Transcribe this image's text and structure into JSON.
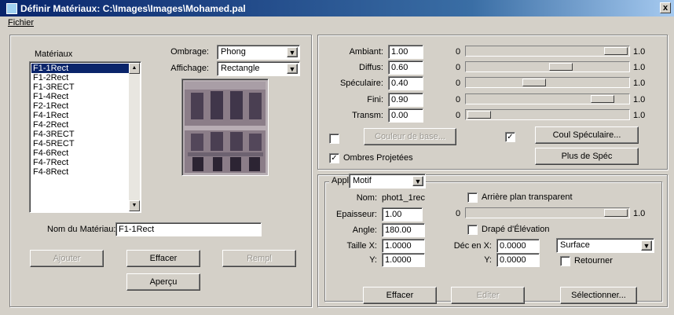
{
  "window": {
    "title": "Définir Matériaux: C:\\Images\\Images\\Mohamed.pal",
    "close_glyph": "x"
  },
  "menu": {
    "file": "Fichier"
  },
  "materials": {
    "list_label": "Matériaux",
    "items": [
      "F1-1Rect",
      "F1-2Rect",
      "F1-3RECT",
      "F1-4Rect",
      "F2-1Rect",
      "F4-1Rect",
      "F4-2Rect",
      "F4-3RECT",
      "F4-5RECT",
      "F4-6Rect",
      "F4-7Rect",
      "F4-8Rect"
    ],
    "selected_index": 0,
    "name_label": "Nom du Matériau:",
    "name_value": "F1-1Rect"
  },
  "shading": {
    "label": "Ombrage:",
    "value": "Phong"
  },
  "display": {
    "label": "Affichage:",
    "value": "Rectangle"
  },
  "left_buttons": {
    "add": "Ajouter",
    "delete": "Effacer",
    "fill": "Rempl",
    "preview": "Aperçu"
  },
  "properties": [
    {
      "label": "Ambiant:",
      "value": "1.00",
      "min": "0",
      "max": "1.0",
      "level": 1.0
    },
    {
      "label": "Diffus:",
      "value": "0.60",
      "min": "0",
      "max": "1.0",
      "level": 0.6
    },
    {
      "label": "Spéculaire:",
      "value": "0.40",
      "min": "0",
      "max": "1.0",
      "level": 0.4
    },
    {
      "label": "Fini:",
      "value": "0.90",
      "min": "0",
      "max": "1.0",
      "level": 0.9
    },
    {
      "label": "Transm:",
      "value": "0.00",
      "min": "0",
      "max": "1.0",
      "level": 0.0
    }
  ],
  "colors": {
    "base_button": "Couleur de base...",
    "base_checked": false,
    "specular_button": "Coul Spéculaire...",
    "specular_checked": true,
    "shadows_label": "Ombres Projetées",
    "shadows_checked": true,
    "more_spec_button": "Plus de Spéc"
  },
  "mapping": {
    "appli_label": "Appli",
    "appli_value": "Motif",
    "name_label": "Nom:",
    "name_value": "phot1_1rec",
    "thickness_label": "Epaisseur:",
    "thickness_value": "1.00",
    "angle_label": "Angle:",
    "angle_value": "180.00",
    "size_x_label": "Taille X:",
    "size_x_value": "1.0000",
    "size_y_label": "Y:",
    "size_y_value": "1.0000",
    "backplane_label": "Arrière plan transparent",
    "backplane_checked": false,
    "slider_min": "0",
    "slider_max": "1.0",
    "slider_level": 1.0,
    "drape_label": "Drapé d'Élévation",
    "drape_checked": false,
    "offset_x_label": "Déc en X:",
    "offset_x_value": "0.0000",
    "offset_y_label": "Y:",
    "offset_y_value": "0.0000",
    "surface_value": "Surface",
    "flip_label": "Retourner",
    "flip_checked": false
  },
  "bottom_buttons": {
    "delete": "Effacer",
    "edit": "Editer",
    "select": "Sélectionner..."
  },
  "icons": {
    "dropdown": "▼",
    "scroll_up": "▲",
    "scroll_down": "▼",
    "check": "✓"
  }
}
